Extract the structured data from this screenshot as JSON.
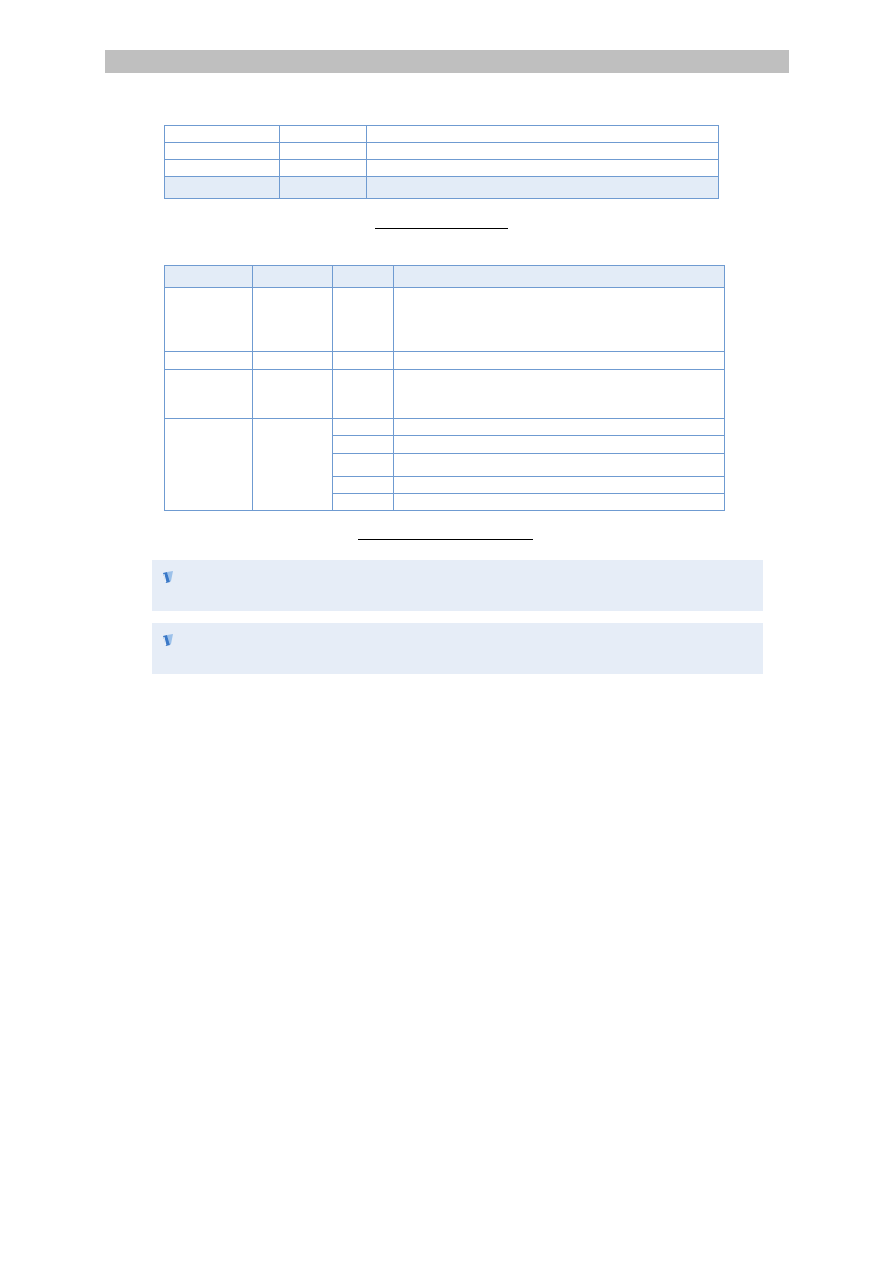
{
  "header": {
    "title": ""
  },
  "tables": {
    "table1": {
      "rows": [
        [
          "",
          "",
          ""
        ],
        [
          "",
          "",
          ""
        ],
        [
          "",
          "",
          ""
        ],
        [
          "",
          "",
          ""
        ]
      ]
    },
    "table2": {
      "head": [
        "",
        "",
        "",
        ""
      ],
      "rows": [
        [
          "",
          "",
          "",
          ""
        ],
        [
          "",
          "",
          "",
          ""
        ],
        [
          "",
          "",
          "",
          ""
        ]
      ],
      "group": {
        "col1": "",
        "col2": "",
        "sub": [
          [
            "",
            ""
          ],
          [
            "",
            ""
          ],
          [
            "",
            ""
          ],
          [
            "",
            ""
          ],
          [
            "",
            ""
          ]
        ]
      }
    }
  },
  "captions": {
    "table1": "",
    "table2": ""
  },
  "notes": [
    {
      "icon": "note-icon",
      "text": ""
    },
    {
      "icon": "note-icon",
      "text": ""
    }
  ],
  "colors": {
    "header_bar": "#bfbfbf",
    "table_border": "#6f9bd1",
    "table_highlight": "#e3ecf7",
    "note_background": "#e6edf7",
    "note_icon": "#3a78c7"
  }
}
